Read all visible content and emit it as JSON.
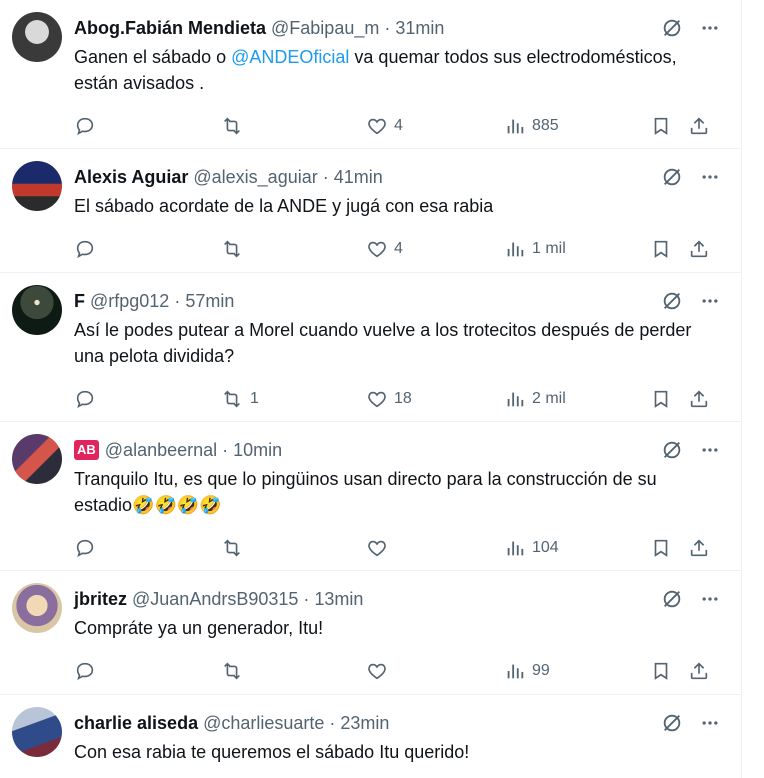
{
  "tweets": [
    {
      "name": "Abog.Fabián Mendieta",
      "handle": "@Fabipau_m",
      "time": "31min",
      "text_before": "Ganen el sábado o ",
      "mention": "@ANDEOficial",
      "text_after": " va quemar  todos sus electrodomésticos, están avisados .",
      "replies": "",
      "retweets": "",
      "likes": "4",
      "views": "885",
      "avatar_colors": [
        "#3a3a3a",
        "#d9d9d9"
      ]
    },
    {
      "name": "Alexis Aguiar",
      "handle": "@alexis_aguiar",
      "time": "41min",
      "text": "El sábado acordate de la ANDE y jugá con esa rabia",
      "replies": "",
      "retweets": "",
      "likes": "4",
      "views": "1 mil",
      "avatar_colors": [
        "#1b2a6b",
        "#c0392b"
      ]
    },
    {
      "name": "F",
      "handle": "@rfpg012",
      "time": "57min",
      "text": "Así le podes putear a Morel cuando vuelve a los trotecitos después de perder una pelota dividida?",
      "replies": "",
      "retweets": "1",
      "likes": "18",
      "views": "2 mil",
      "avatar_colors": [
        "#0e1a14",
        "#6b7d63"
      ]
    },
    {
      "name": "",
      "badge": "AB",
      "handle": "@alanbeernal",
      "time": "10min",
      "text": "Tranquilo Itu, es que lo pingüinos usan directo para la construcción de su estadio🤣🤣🤣🤣",
      "replies": "",
      "retweets": "",
      "likes": "",
      "views": "104",
      "avatar_colors": [
        "#5a3a6b",
        "#d4564a"
      ]
    },
    {
      "name": "jbritez",
      "handle": "@JuanAndrsB90315",
      "time": "13min",
      "text": "Compráte ya un generador, Itu!",
      "replies": "",
      "retweets": "",
      "likes": "",
      "views": "99",
      "avatar_colors": [
        "#d9c6a5",
        "#8a6e9e"
      ]
    },
    {
      "name": "charlie aliseda",
      "handle": "@charliesuarte",
      "time": "23min",
      "text": "Con esa rabia te queremos el sábado Itu querido!",
      "replies": "",
      "retweets": "",
      "likes": "",
      "views": "",
      "avatar_colors": [
        "#2f4b8a",
        "#b8c4d8"
      ]
    }
  ],
  "colors": {
    "text": "#0f1419",
    "secondary": "#536471",
    "mention": "#1d9bf0",
    "divider": "#eff3f4",
    "badge": "#e0245e"
  }
}
